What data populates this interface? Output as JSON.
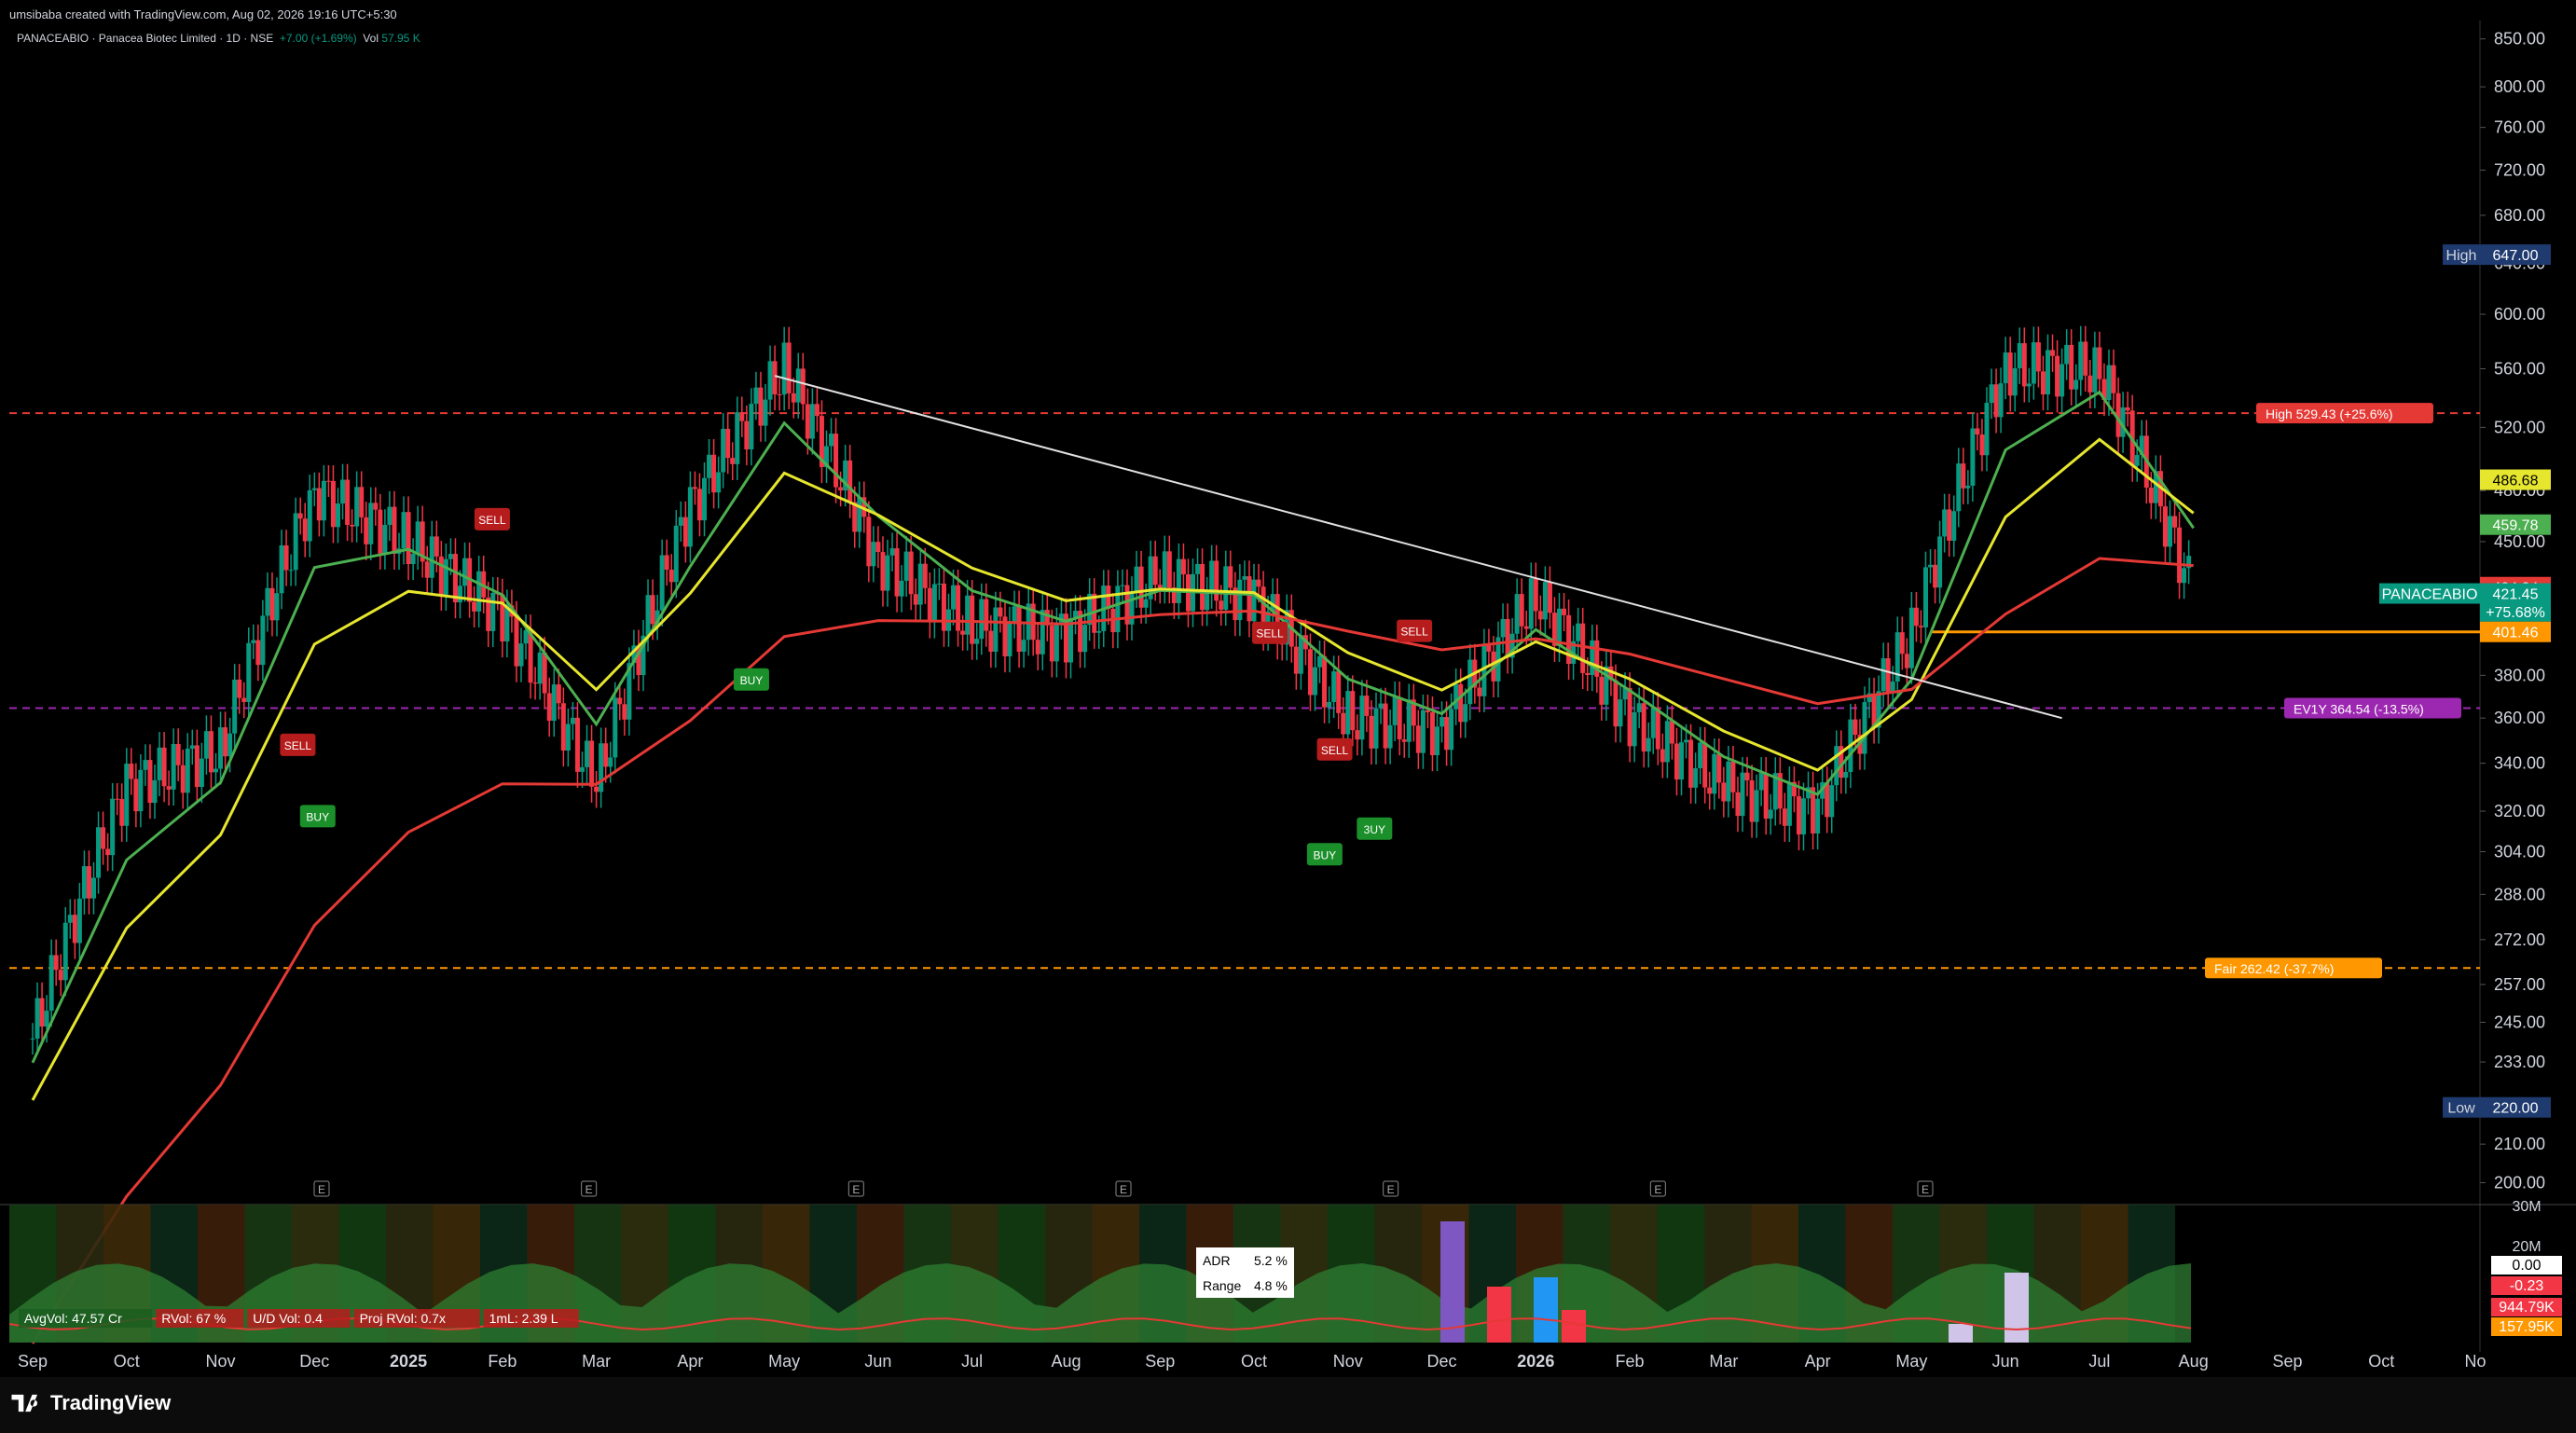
{
  "header": {
    "creator": "umsibaba created with TradingView.com, Aug 02, 2026 19:16 UTC+5:30",
    "symbol_line": "PANACEABIO · Panacea Biotec Limited · 1D · NSE",
    "change": "+7.00 (+1.69%)",
    "volume_label": "Vol",
    "volume": "57.95 K"
  },
  "brand": {
    "name": "TradingView"
  },
  "colors": {
    "background": "#000000",
    "up": "#089981",
    "down": "#f23645",
    "ema_fast": "#4caf50",
    "ema_mid": "#e6e62e",
    "ema_slow": "#e53935",
    "trendline": "#e0e0e0",
    "support": "#ff9800"
  },
  "chart_data": {
    "type": "candlestick",
    "symbol": "PANACEABIO",
    "timeframe": "1D",
    "x_months": [
      "Sep",
      "Oct",
      "Nov",
      "Dec",
      "2025",
      "Feb",
      "Mar",
      "Apr",
      "May",
      "Jun",
      "Jul",
      "Aug",
      "Sep",
      "Oct",
      "Nov",
      "Dec",
      "2026",
      "Feb",
      "Mar",
      "Apr",
      "May",
      "Jun",
      "Jul",
      "Aug",
      "Sep",
      "Oct",
      "No"
    ],
    "y_ticks": [
      850,
      800,
      760,
      720,
      680,
      640,
      600,
      560,
      520,
      480,
      450,
      420,
      380,
      360,
      340,
      320,
      304,
      288,
      272,
      257,
      245,
      233,
      210,
      200
    ],
    "ylim": [
      195,
      870
    ],
    "series_monthly_close": [
      {
        "m": "Sep",
        "v": 240
      },
      {
        "m": "Oct",
        "v": 330
      },
      {
        "m": "Nov",
        "v": 345
      },
      {
        "m": "Dec",
        "v": 480
      },
      {
        "m": "2025",
        "v": 450
      },
      {
        "m": "Feb",
        "v": 410
      },
      {
        "m": "Mar",
        "v": 330
      },
      {
        "m": "Apr",
        "v": 470
      },
      {
        "m": "May",
        "v": 560
      },
      {
        "m": "Jun",
        "v": 440
      },
      {
        "m": "Jul",
        "v": 405
      },
      {
        "m": "Aug",
        "v": 400
      },
      {
        "m": "Sep",
        "v": 430
      },
      {
        "m": "Oct",
        "v": 420
      },
      {
        "m": "Nov",
        "v": 360
      },
      {
        "m": "Dec",
        "v": 355
      },
      {
        "m": "2026",
        "v": 420
      },
      {
        "m": "Feb",
        "v": 360
      },
      {
        "m": "Mar",
        "v": 330
      },
      {
        "m": "Apr",
        "v": 320
      },
      {
        "m": "May",
        "v": 400
      },
      {
        "m": "Jun",
        "v": 560
      },
      {
        "m": "Jul",
        "v": 560
      },
      {
        "m": "Aug",
        "v": 421
      }
    ],
    "price_labels": [
      {
        "text": "High",
        "value": "647.00",
        "y": 647,
        "color": "#1e3a6e"
      },
      {
        "text": "",
        "value": "486.68",
        "y": 486.68,
        "color": "#e6e62e"
      },
      {
        "text": "",
        "value": "459.78",
        "y": 459.78,
        "color": "#4caf50"
      },
      {
        "text": "",
        "value": "424.84",
        "y": 424.84,
        "color": "#e53935"
      },
      {
        "text": "PANACEABIO",
        "value": "421.45",
        "y": 421.45,
        "color": "#089981"
      },
      {
        "text": "",
        "value": "+75.68%",
        "y": 412,
        "color": "#089981"
      },
      {
        "text": "",
        "value": "401.46",
        "y": 401.46,
        "color": "#ff9800"
      },
      {
        "text": "Low",
        "value": "220.00",
        "y": 220,
        "color": "#1e3a6e"
      }
    ],
    "levels": [
      {
        "label": "High 529.43 (+25.6%)",
        "y": 529.43,
        "color": "#e53935"
      },
      {
        "label": "EV1Y 364.54 (-13.5%)",
        "y": 364.54,
        "color": "#9c27b0"
      },
      {
        "label": "Fair 262.42 (-37.7%)",
        "y": 262.42,
        "color": "#ff9800"
      }
    ],
    "signals": [
      {
        "text": "SELL",
        "m": 2.65,
        "y": 348
      },
      {
        "text": "BUY",
        "m": 2.85,
        "y": 318
      },
      {
        "text": "SELL",
        "m": 4.6,
        "y": 463
      },
      {
        "text": "BUY",
        "m": 7.2,
        "y": 378
      },
      {
        "text": "SELL",
        "m": 12.4,
        "y": 401
      },
      {
        "text": "SELL",
        "m": 13.05,
        "y": 346
      },
      {
        "text": "BUY",
        "m": 12.95,
        "y": 303
      },
      {
        "text": "3UY",
        "m": 13.45,
        "y": 313
      },
      {
        "text": "SELL",
        "m": 13.85,
        "y": 402
      }
    ],
    "indicator_panel": {
      "ticks": [
        "30M",
        "20M",
        "0.00",
        "-0.23",
        "944.79K",
        "157.95K"
      ],
      "adr": {
        "ADR": "5.2 %",
        "Range": "4.8 %"
      },
      "stats": [
        "AvgVol: 47.57 Cr",
        "RVol: 67 %",
        "U/D Vol: 0.4",
        "Proj RVol: 0.7x",
        "1mL: 2.39 L"
      ]
    }
  }
}
